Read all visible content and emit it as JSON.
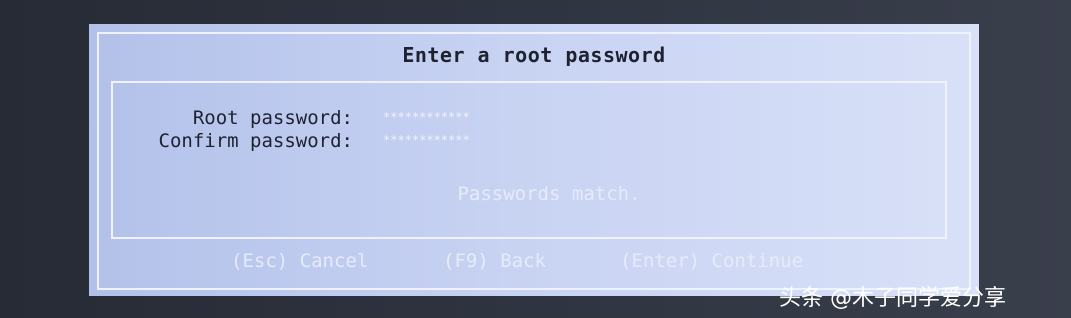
{
  "dialog": {
    "title": "Enter a root password",
    "fields": [
      {
        "label": "Root password:",
        "value": "************"
      },
      {
        "label": "Confirm password:",
        "value": "************"
      }
    ],
    "status": "Passwords match.",
    "buttons": {
      "cancel": "(Esc) Cancel",
      "back": "(F9) Back",
      "continue": "(Enter) Continue"
    }
  },
  "watermark": "头条 @木子同学爱分享",
  "colors": {
    "dialog_bg": "#c7d2f2",
    "text_dark": "#1d2130",
    "text_light": "#e6ebfa",
    "screen_bg": "#2b2f3a"
  }
}
